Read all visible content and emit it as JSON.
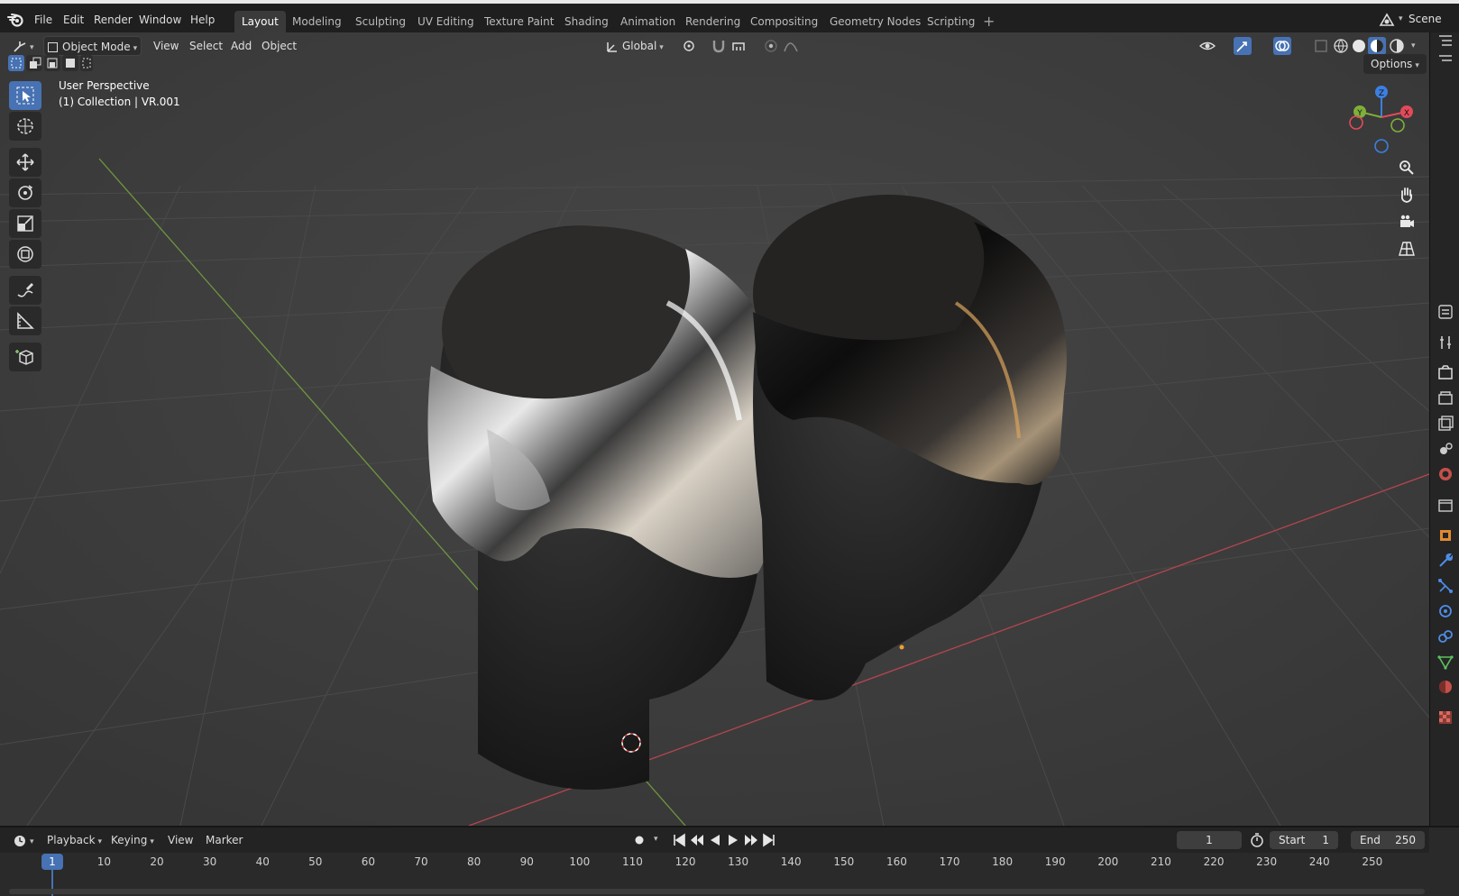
{
  "menu": [
    "File",
    "Edit",
    "Render",
    "Window",
    "Help"
  ],
  "workspaces": [
    "Layout",
    "Modeling",
    "Sculpting",
    "UV Editing",
    "Texture Paint",
    "Shading",
    "Animation",
    "Rendering",
    "Compositing",
    "Geometry Nodes",
    "Scripting"
  ],
  "active_workspace": "Layout",
  "scene": {
    "label": "Scene"
  },
  "viewport_header": {
    "mode": "Object Mode",
    "menus": [
      "View",
      "Select",
      "Add",
      "Object"
    ],
    "transform_orientation": "Global",
    "options_label": "Options"
  },
  "overlay": {
    "perspective": "User Perspective",
    "collection": "(1) Collection | VR.001"
  },
  "gizmo": {
    "z": "Z",
    "y": "Y",
    "x": "X"
  },
  "timeline": {
    "menus": [
      "Playback",
      "Keying",
      "View",
      "Marker"
    ],
    "current_frame": "1",
    "start_label": "Start",
    "start_value": "1",
    "end_label": "End",
    "end_value": "250",
    "cursor_frame": "1",
    "ticks": [
      "10",
      "20",
      "30",
      "40",
      "50",
      "60",
      "70",
      "80",
      "90",
      "100",
      "110",
      "120",
      "130",
      "140",
      "150",
      "160",
      "170",
      "180",
      "190",
      "200",
      "210",
      "220",
      "230",
      "240",
      "250"
    ]
  },
  "colors": {
    "accent": "#4772b3",
    "axis_x": "#e34a5a",
    "axis_y": "#7fb03a",
    "axis_z": "#3d7fe0"
  }
}
